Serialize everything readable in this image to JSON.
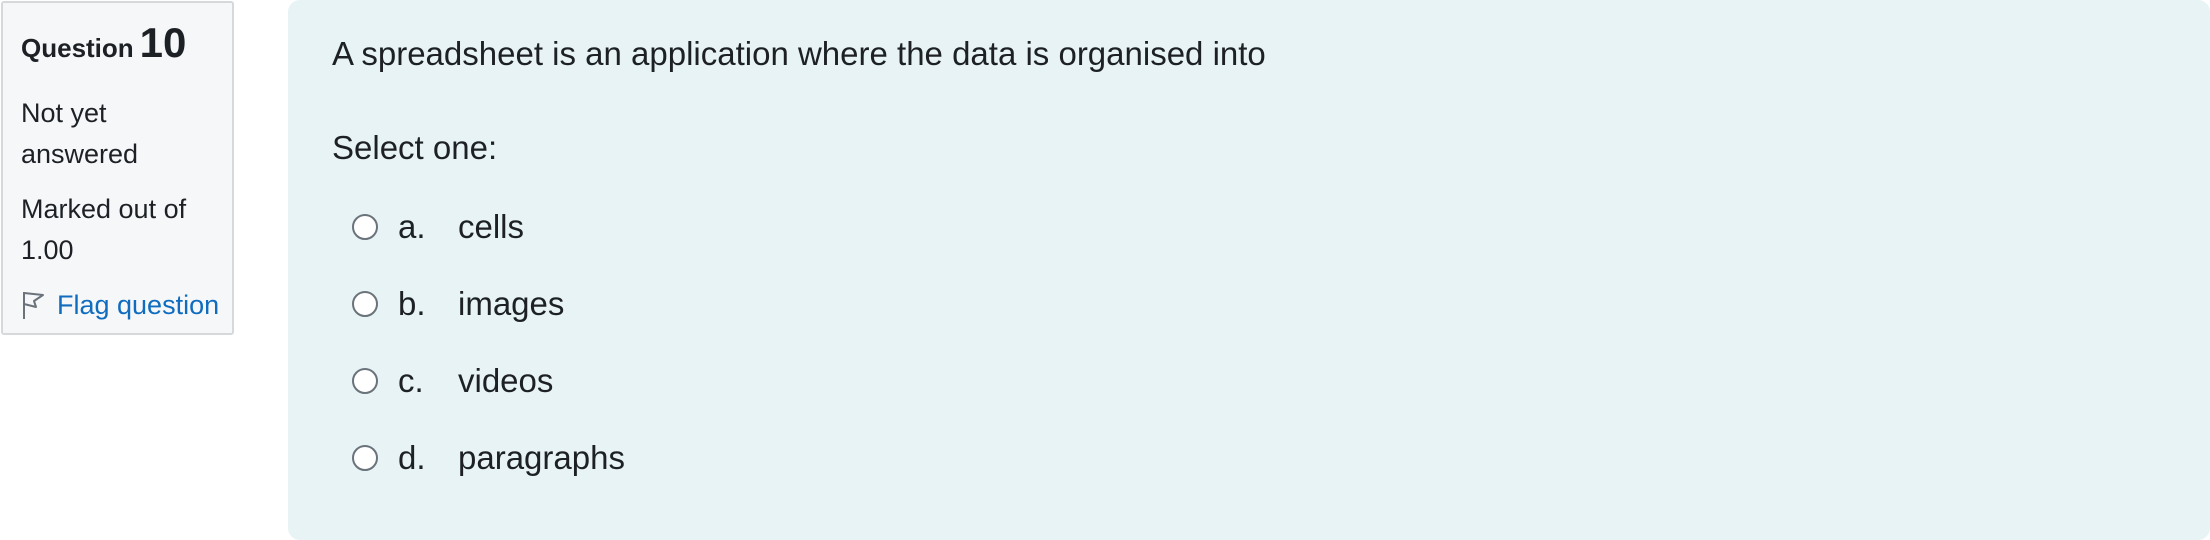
{
  "question": {
    "label": "Question",
    "number": "10",
    "state": "Not yet answered",
    "grade": "Marked out of 1.00",
    "flag_label": "Flag question"
  },
  "content": {
    "question_text": "A spreadsheet is an application where the data is organised into",
    "prompt": "Select one:",
    "answers": [
      {
        "letter": "a.",
        "text": "cells"
      },
      {
        "letter": "b.",
        "text": "images"
      },
      {
        "letter": "c.",
        "text": "videos"
      },
      {
        "letter": "d.",
        "text": "paragraphs"
      }
    ]
  },
  "icons": {
    "flag": "flag-icon",
    "radio": "radio-button"
  },
  "colors": {
    "link": "#0f6cbf",
    "content_bg": "#e7f3f5",
    "info_bg": "#f6f7f9"
  }
}
